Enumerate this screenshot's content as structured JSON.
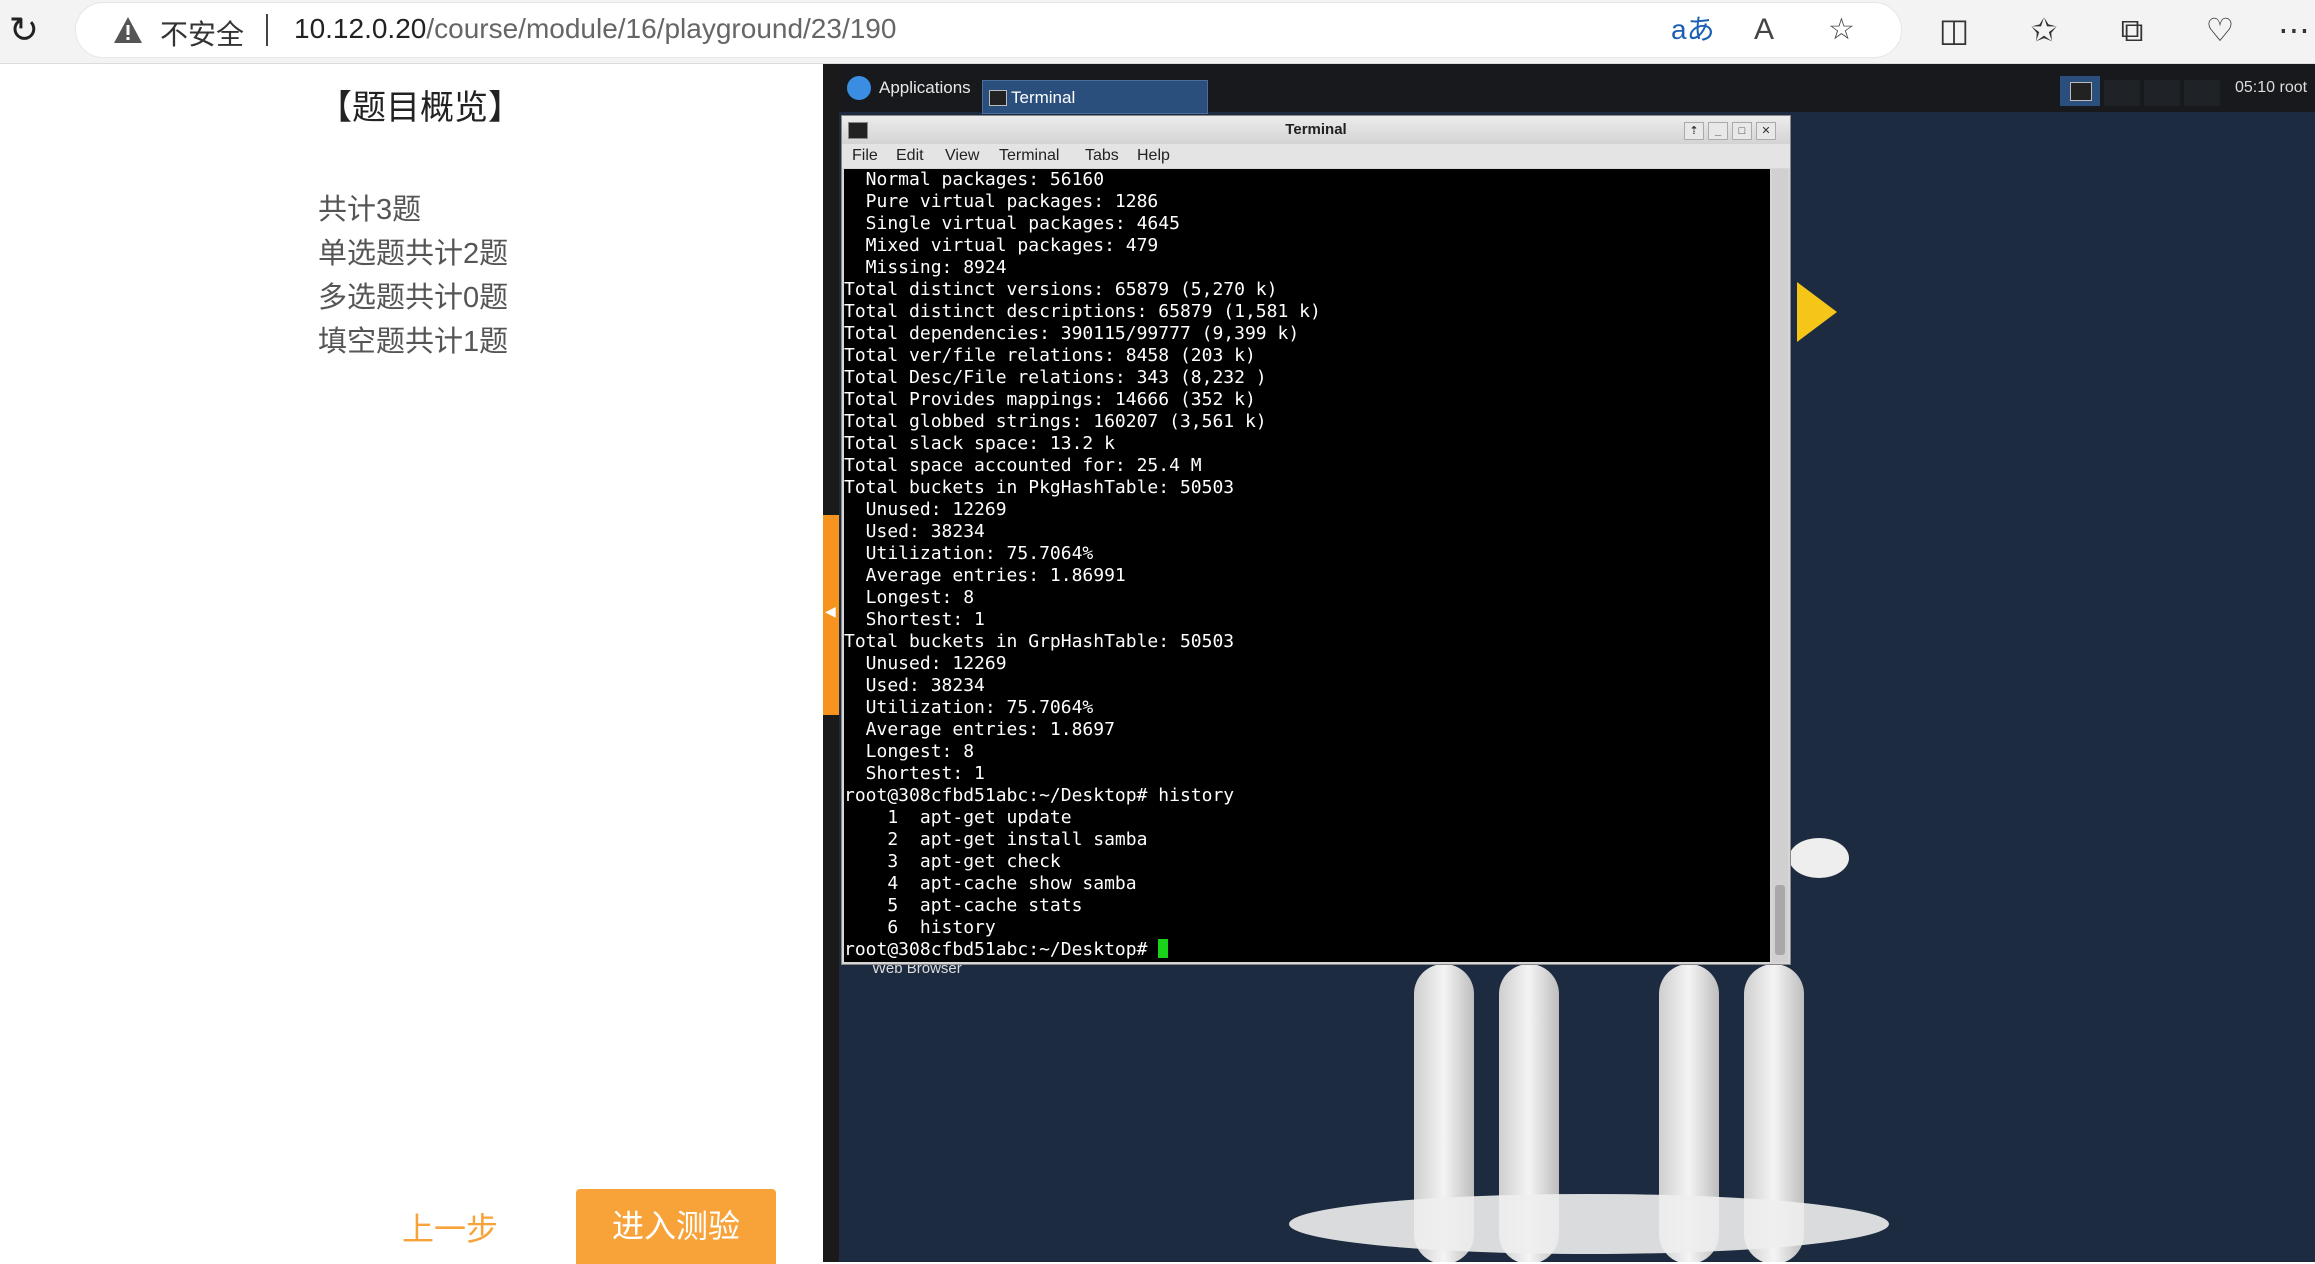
{
  "browser": {
    "security_label": "不安全",
    "url_host": "10.12.0.20",
    "url_path": "/course/module/16/playground/23/190",
    "read_aloud_icon": "A",
    "translate_icon": "aあ"
  },
  "overview": {
    "title": "【题目概览】",
    "total": "共计3题",
    "single": "单选题共计2题",
    "multi": "多选题共计0题",
    "fill": "填空题共计1题",
    "prev_label": "上一步",
    "start_label": "进入测验"
  },
  "desktop": {
    "apps_label": "Applications",
    "task_terminal": "Terminal",
    "clock": "05:10 root",
    "web_browser_label": "Web Browser"
  },
  "terminal": {
    "title": "Terminal",
    "menu": [
      "File",
      "Edit",
      "View",
      "Terminal",
      "Tabs",
      "Help"
    ],
    "lines": [
      "  Normal packages: 56160",
      "  Pure virtual packages: 1286",
      "  Single virtual packages: 4645",
      "  Mixed virtual packages: 479",
      "  Missing: 8924",
      "Total distinct versions: 65879 (5,270 k)",
      "Total distinct descriptions: 65879 (1,581 k)",
      "Total dependencies: 390115/99777 (9,399 k)",
      "Total ver/file relations: 8458 (203 k)",
      "Total Desc/File relations: 343 (8,232 )",
      "Total Provides mappings: 14666 (352 k)",
      "Total globbed strings: 160207 (3,561 k)",
      "Total slack space: 13.2 k",
      "Total space accounted for: 25.4 M",
      "Total buckets in PkgHashTable: 50503",
      "  Unused: 12269",
      "  Used: 38234",
      "  Utilization: 75.7064%",
      "  Average entries: 1.86991",
      "  Longest: 8",
      "  Shortest: 1",
      "Total buckets in GrpHashTable: 50503",
      "  Unused: 12269",
      "  Used: 38234",
      "  Utilization: 75.7064%",
      "  Average entries: 1.8697",
      "  Longest: 8",
      "  Shortest: 1",
      "root@308cfbd51abc:~/Desktop# history",
      "    1  apt-get update",
      "    2  apt-get install samba",
      "    3  apt-get check",
      "    4  apt-cache show samba",
      "    5  apt-cache stats",
      "    6  history"
    ],
    "prompt": "root@308cfbd51abc:~/Desktop# "
  }
}
